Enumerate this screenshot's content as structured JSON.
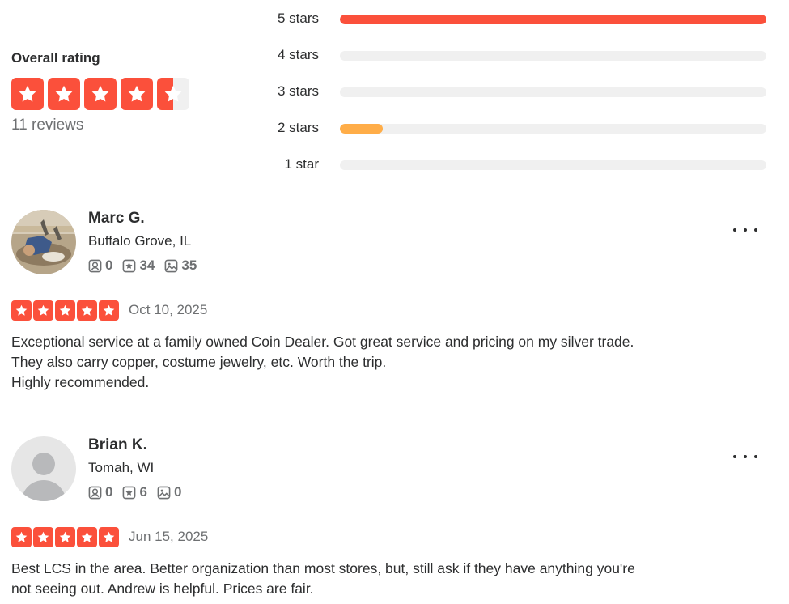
{
  "overall": {
    "title": "Overall rating",
    "rating": 4.5,
    "review_count": "11 reviews"
  },
  "histogram": [
    {
      "label": "5 stars",
      "fraction": 1.0,
      "color": "#fb503b"
    },
    {
      "label": "4 stars",
      "fraction": 0.0,
      "color": "#fb503b"
    },
    {
      "label": "3 stars",
      "fraction": 0.0,
      "color": "#fb503b"
    },
    {
      "label": "2 stars",
      "fraction": 0.1,
      "color": "#ffad48"
    },
    {
      "label": "1 star",
      "fraction": 0.0,
      "color": "#fb503b"
    }
  ],
  "reviews": [
    {
      "name": "Marc G.",
      "location": "Buffalo Grove, IL",
      "friends": "0",
      "reviews": "34",
      "photos": "35",
      "rating": 5,
      "date": "Oct 10, 2025",
      "text": [
        "Exceptional service at a family owned Coin Dealer. Got great service and pricing on my silver trade.",
        "They also carry copper, costume jewelry, etc. Worth the trip.",
        "Highly recommended."
      ]
    },
    {
      "name": "Brian K.",
      "location": "Tomah, WI",
      "friends": "0",
      "reviews": "6",
      "photos": "0",
      "rating": 5,
      "date": "Jun 15, 2025",
      "text": [
        "Best LCS in the area. Better organization than most stores, but, still ask if they have anything you're",
        "not seeing out. Andrew is helpful. Prices are fair."
      ]
    }
  ],
  "colors": {
    "star_red": "#fb503b",
    "bar_orange": "#ffad48",
    "track_gray": "#f0f0f0",
    "muted_text": "#6e7072"
  },
  "icons": [
    "star-icon",
    "friends-icon",
    "reviews-icon",
    "photos-icon",
    "more-options-icon"
  ]
}
